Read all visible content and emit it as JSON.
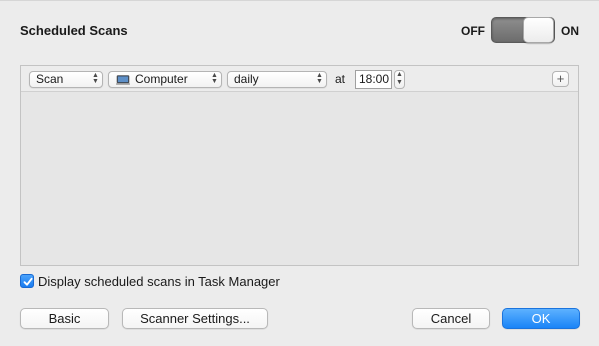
{
  "header": {
    "title": "Scheduled Scans",
    "toggle_off_label": "OFF",
    "toggle_on_label": "ON",
    "toggle_state": "on"
  },
  "schedule_row": {
    "scan_type": "Scan",
    "target": "Computer",
    "target_icon": "computer-icon",
    "frequency": "daily",
    "at_label": "at",
    "time": "18:00",
    "add_icon": "plus-icon"
  },
  "options": {
    "show_in_task_manager_label": "Display scheduled scans in Task Manager",
    "show_in_task_manager_checked": true
  },
  "footer": {
    "basic_label": "Basic",
    "scanner_settings_label": "Scanner Settings...",
    "cancel_label": "Cancel",
    "ok_label": "OK"
  },
  "colors": {
    "accent": "#1a84f7",
    "window_bg": "#ececec"
  }
}
